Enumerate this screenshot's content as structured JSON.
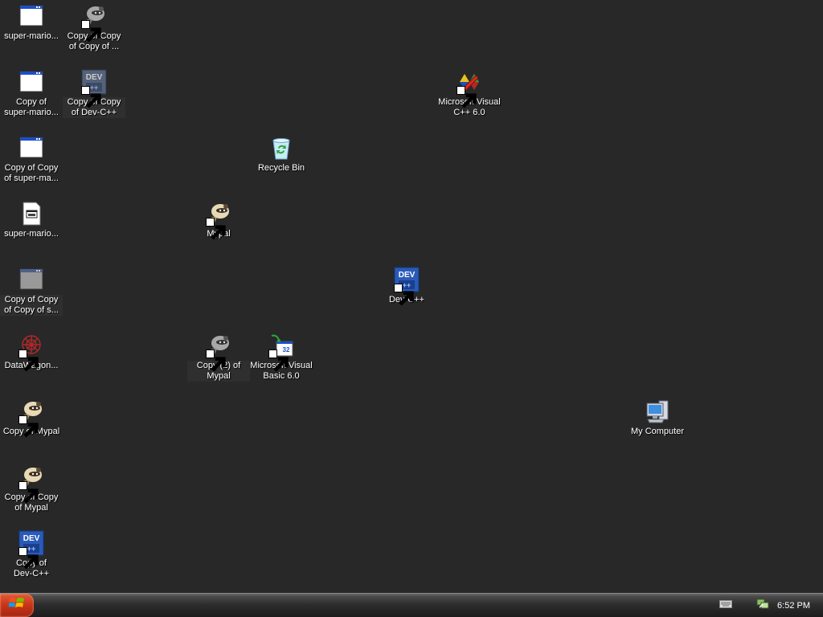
{
  "desktop": {
    "icons": [
      {
        "label": "super-mario..."
      },
      {
        "label": "Copy of\nsuper-mario..."
      },
      {
        "label": "Copy of Copy\nof super-ma..."
      },
      {
        "label": "super-mario..."
      },
      {
        "label": "Copy of Copy\nof Copy of s..."
      },
      {
        "label": "DataWagon..."
      },
      {
        "label": "Copy of Mypal"
      },
      {
        "label": "Copy of Copy\nof Mypal"
      },
      {
        "label": "Copy of\nDev-C++"
      },
      {
        "label": "Copy of Copy\nof Copy of ..."
      },
      {
        "label": "Copy of Copy\nof Dev-C++"
      },
      {
        "label": "Mypal"
      },
      {
        "label": "Copy (2) of\nMypal"
      },
      {
        "label": "Recycle Bin"
      },
      {
        "label": "Microsoft Visual\nBasic 6.0"
      },
      {
        "label": "Dev-C++"
      },
      {
        "label": "Microsoft Visual\nC++ 6.0"
      },
      {
        "label": "My Computer"
      }
    ]
  },
  "taskbar": {
    "clock": "6:52 PM"
  }
}
